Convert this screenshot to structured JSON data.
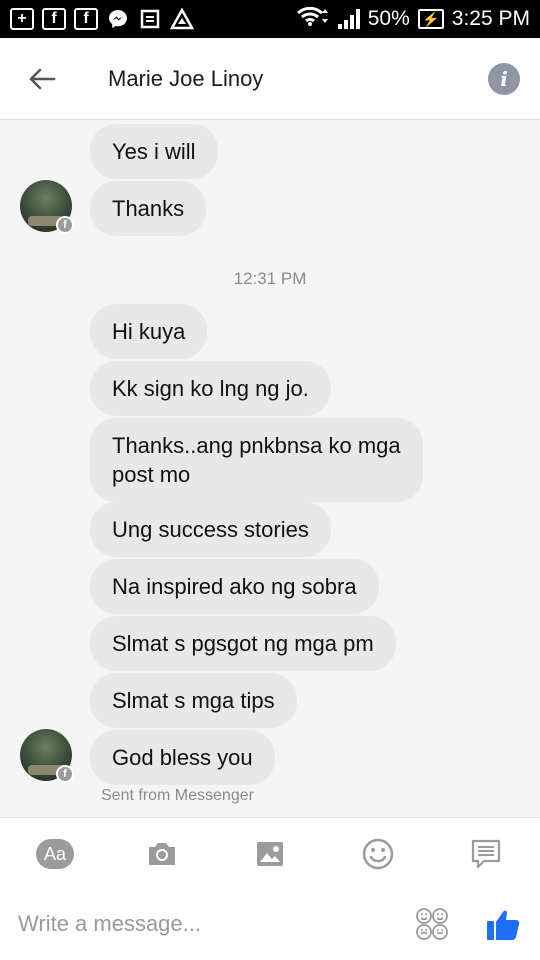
{
  "status_bar": {
    "battery": "50%",
    "time": "3:25 PM"
  },
  "header": {
    "title": "Marie Joe Linoy"
  },
  "messages_group1": [
    {
      "text": "Yes i will"
    },
    {
      "text": "Thanks"
    }
  ],
  "timestamp": "12:31 PM",
  "messages_group2": [
    {
      "text": "Hi kuya"
    },
    {
      "text": "Kk sign ko lng ng jo."
    },
    {
      "text": "Thanks..ang pnkbnsa ko mga\npost mo"
    },
    {
      "text": "Ung success stories"
    },
    {
      "text": "Na inspired ako ng sobra"
    },
    {
      "text": "Slmat s pgsgot ng mga pm"
    },
    {
      "text": "Slmat s mga tips"
    },
    {
      "text": "God bless you"
    }
  ],
  "sent_from": "Sent from Messenger",
  "composer": {
    "aa_label": "Aa",
    "placeholder": "Write a message..."
  },
  "colors": {
    "bubble": "#e8e8e8",
    "like_blue": "#1e6ff5",
    "icon_gray": "#9b9b9b"
  }
}
